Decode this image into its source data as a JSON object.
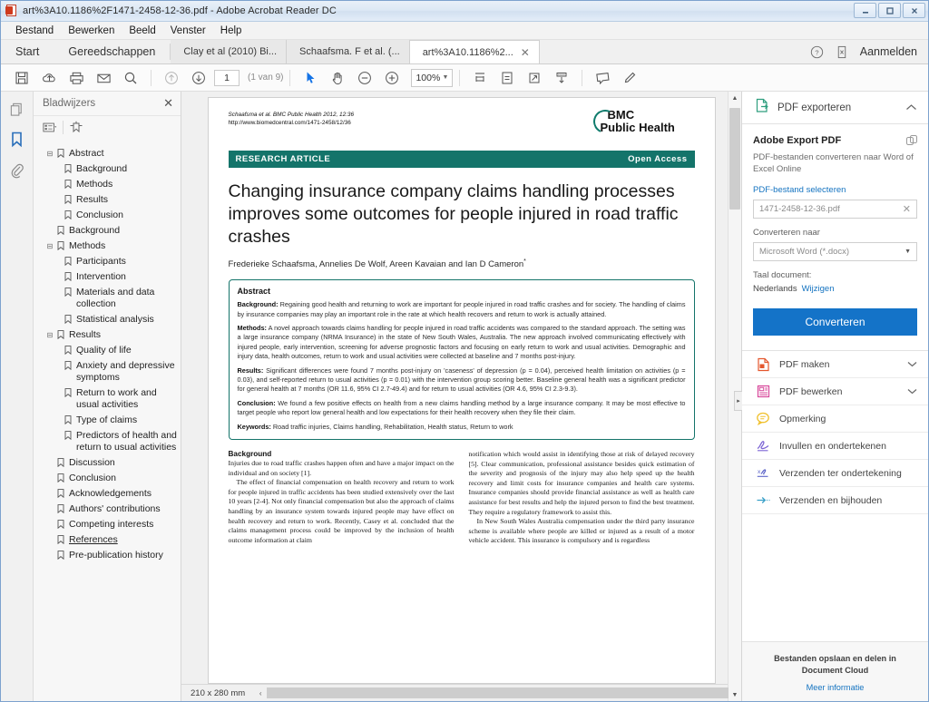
{
  "window": {
    "title": "art%3A10.1186%2F1471-2458-12-36.pdf - Adobe Acrobat Reader DC",
    "minimize": "–",
    "maximize": "□",
    "close": "✕"
  },
  "menubar": {
    "items": [
      {
        "label": "Bestand"
      },
      {
        "label": "Bewerken"
      },
      {
        "label": "Beeld"
      },
      {
        "label": "Venster"
      },
      {
        "label": "Help"
      }
    ]
  },
  "tabbar": {
    "home": "Start",
    "tools": "Gereedschappen",
    "documents": [
      {
        "label": "Clay et al (2010) Bi...",
        "active": false
      },
      {
        "label": "Schaafsma. F et al. (...",
        "active": false
      },
      {
        "label": "art%3A10.1186%2...",
        "active": true
      }
    ],
    "close_glyph": "✕",
    "sign_in": "Aanmelden"
  },
  "toolbar": {
    "page_value": "1",
    "page_of": "(1 van 9)",
    "zoom_value": "100%",
    "icons": [
      "save-icon",
      "cloud-upload-icon",
      "print-icon",
      "email-icon",
      "search-icon",
      "previous-page-icon",
      "next-page-icon",
      "select-tool-icon",
      "hand-tool-icon",
      "zoom-out-icon",
      "zoom-in-icon",
      "fit-width-icon",
      "fit-page-icon",
      "rotate-icon",
      "scroll-mode-icon",
      "comment-icon",
      "highlight-icon"
    ]
  },
  "rail": {
    "items": [
      {
        "name": "page-thumbnails-icon",
        "selected": false
      },
      {
        "name": "bookmarks-icon",
        "selected": true
      },
      {
        "name": "attachments-icon",
        "selected": false
      }
    ]
  },
  "bookmarks": {
    "title": "Bladwijzers",
    "close": "✕",
    "options_icon": "bookmark-options-icon",
    "new_bookmark_icon": "new-bookmark-icon",
    "items": [
      {
        "label": "Abstract",
        "level": 0,
        "expandable": true,
        "twisty": "⊟",
        "underline": false
      },
      {
        "label": "Background",
        "level": 1,
        "expandable": false,
        "twisty": "",
        "underline": false
      },
      {
        "label": "Methods",
        "level": 1,
        "expandable": false,
        "twisty": "",
        "underline": false
      },
      {
        "label": "Results",
        "level": 1,
        "expandable": false,
        "twisty": "",
        "underline": false
      },
      {
        "label": "Conclusion",
        "level": 1,
        "expandable": false,
        "twisty": "",
        "underline": false
      },
      {
        "label": "Background",
        "level": 0,
        "expandable": false,
        "twisty": "",
        "underline": false
      },
      {
        "label": "Methods",
        "level": 0,
        "expandable": true,
        "twisty": "⊟",
        "underline": false
      },
      {
        "label": "Participants",
        "level": 1,
        "expandable": false,
        "twisty": "",
        "underline": false
      },
      {
        "label": "Intervention",
        "level": 1,
        "expandable": false,
        "twisty": "",
        "underline": false
      },
      {
        "label": "Materials and data collection",
        "level": 1,
        "expandable": false,
        "twisty": "",
        "underline": false
      },
      {
        "label": "Statistical analysis",
        "level": 1,
        "expandable": false,
        "twisty": "",
        "underline": false
      },
      {
        "label": "Results",
        "level": 0,
        "expandable": true,
        "twisty": "⊟",
        "underline": false
      },
      {
        "label": "Quality of life",
        "level": 1,
        "expandable": false,
        "twisty": "",
        "underline": false
      },
      {
        "label": "Anxiety and depressive symptoms",
        "level": 1,
        "expandable": false,
        "twisty": "",
        "underline": false
      },
      {
        "label": "Return to work and usual activities",
        "level": 1,
        "expandable": false,
        "twisty": "",
        "underline": false
      },
      {
        "label": "Type of claims",
        "level": 1,
        "expandable": false,
        "twisty": "",
        "underline": false
      },
      {
        "label": "Predictors of health and return to usual activities",
        "level": 1,
        "expandable": false,
        "twisty": "",
        "underline": false
      },
      {
        "label": "Discussion",
        "level": 0,
        "expandable": false,
        "twisty": "",
        "underline": false
      },
      {
        "label": "Conclusion",
        "level": 0,
        "expandable": false,
        "twisty": "",
        "underline": false
      },
      {
        "label": "Acknowledgements",
        "level": 0,
        "expandable": false,
        "twisty": "",
        "underline": false
      },
      {
        "label": "Authors' contributions",
        "level": 0,
        "expandable": false,
        "twisty": "",
        "underline": false
      },
      {
        "label": "Competing interests",
        "level": 0,
        "expandable": false,
        "twisty": "",
        "underline": false
      },
      {
        "label": "References",
        "level": 0,
        "expandable": false,
        "twisty": "",
        "underline": true
      },
      {
        "label": "Pre-publication history",
        "level": 0,
        "expandable": false,
        "twisty": "",
        "underline": false
      }
    ]
  },
  "document": {
    "running_head": "Schaafsma et al. BMC Public Health 2012, 12:36",
    "running_url": "http://www.biomedcentral.com/1471-2458/12/36",
    "logo_line1": "BMC",
    "logo_line2": "Public Health",
    "banner_left": "RESEARCH ARTICLE",
    "banner_right": "Open Access",
    "title": "Changing insurance company claims handling processes improves some outcomes for people injured in road traffic crashes",
    "authors": "Frederieke Schaafsma, Annelies De Wolf, Areen Kavaian and Ian D Cameron",
    "authors_mark": "*",
    "abstract": {
      "heading": "Abstract",
      "sections": [
        {
          "label": "Background:",
          "text": " Regaining good health and returning to work are important for people injured in road traffic crashes and for society. The handling of claims by insurance companies may play an important role in the rate at which health recovers and return to work is actually attained."
        },
        {
          "label": "Methods:",
          "text": " A novel approach towards claims handling for people injured in road traffic accidents was compared to the standard approach. The setting was a large insurance company (NRMA Insurance) in the state of New South Wales, Australia. The new approach involved communicating effectively with injured people, early intervention, screening for adverse prognostic factors and focusing on early return to work and usual activities. Demographic and injury data, health outcomes, return to work and usual activities were collected at baseline and 7 months post-injury."
        },
        {
          "label": "Results:",
          "text": " Significant differences were found 7 months post-injury on 'caseness' of depression (p = 0.04), perceived health limitation on activities (p = 0.03), and self-reported return to usual activities (p = 0.01) with the intervention group scoring better. Baseline general health was a significant predictor for general health at 7 months (OR 11.6, 95% CI 2.7-49.4) and for return to usual activities (OR 4.6, 95% CI 2.3-9.3)."
        },
        {
          "label": "Conclusion:",
          "text": " We found a few positive effects on health from a new claims handling method by a large insurance company. It may be most effective to target people who report low general health and low expectations for their health recovery when they file their claim."
        },
        {
          "label": "Keywords:",
          "text": " Road traffic injuries, Claims handling, Rehabilitation, Health status, Return to work"
        }
      ]
    },
    "body": {
      "left_heading": "Background",
      "left_p1": "Injuries due to road traffic crashes happen often and have a major impact on the individual and on society [1].",
      "left_p2": "The effect of financial compensation on health recovery and return to work for people injured in traffic accidents has been studied extensively over the last 10 years [2-4]. Not only financial compensation but also the approach of claims handling by an insurance system towards injured people may have effect on health recovery and return to work. Recently, Casey et al. concluded that the claims management process could be improved by the inclusion of health outcome information at claim",
      "right_p1": "notification which would assist in identifying those at risk of delayed recovery [5]. Clear communication, professional assistance besides quick estimation of the severity and prognosis of the injury may also help speed up the health recovery and limit costs for insurance companies and health care systems. Insurance companies should provide financial assistance as well as health care assistance for best results and help the injured person to find the best treatment. They require a regulatory framework to assist this.",
      "right_p2": "In New South Wales Australia compensation under the third party insurance scheme is available where people are killed or injured as a result of a motor vehicle accident. This insurance is compulsory and is regardless"
    }
  },
  "statusbar": {
    "page_size": "210 x 280 mm",
    "left_arrow": "‹",
    "right_arrow": "›"
  },
  "tools_panel": {
    "header": "PDF exporteren",
    "header_icon": "export-pdf-icon",
    "collapse_chevron": "⌃",
    "card": {
      "title": "Adobe Export PDF",
      "copy_icon": "copy-icon",
      "description": "PDF-bestanden converteren naar Word of Excel Online",
      "select_link": "PDF-bestand selecteren",
      "file_value": "1471-2458-12-36.pdf",
      "file_clear": "✕",
      "convert_to_label": "Converteren naar",
      "convert_to_value": "Microsoft Word (*.docx)",
      "dropdown_arrow": "▼",
      "language_label": "Taal document:",
      "language_value": "Nederlands",
      "language_change": "Wijzigen",
      "convert_button": "Converteren"
    },
    "tools": [
      {
        "label": "PDF maken",
        "icon": "create-pdf-icon",
        "chevron": "⌄"
      },
      {
        "label": "PDF bewerken",
        "icon": "edit-pdf-icon",
        "chevron": "⌄"
      },
      {
        "label": "Opmerking",
        "icon": "comment-icon",
        "chevron": ""
      },
      {
        "label": "Invullen en ondertekenen",
        "icon": "fill-sign-icon",
        "chevron": ""
      },
      {
        "label": "Verzenden ter ondertekening",
        "icon": "send-for-signature-icon",
        "chevron": ""
      },
      {
        "label": "Verzenden en bijhouden",
        "icon": "send-track-icon",
        "chevron": ""
      }
    ],
    "footer": {
      "text": "Bestanden opslaan en delen in Document Cloud",
      "link": "Meer informatie"
    }
  },
  "colors": {
    "accent_blue": "#1473c8",
    "journal_green": "#14746a",
    "link_blue": "#1473c0"
  }
}
